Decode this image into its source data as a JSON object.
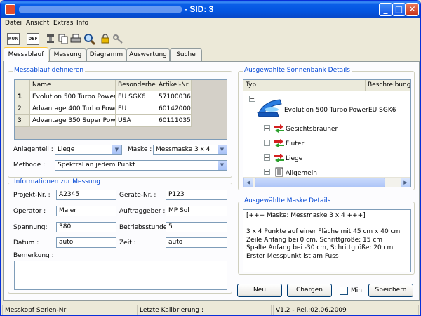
{
  "window": {
    "title": "- SID: 3",
    "controls": {
      "minimize": "_",
      "maximize": "□",
      "close": "✕"
    }
  },
  "menu": [
    "Datei",
    "Ansicht",
    "Extras",
    "Info"
  ],
  "toolbar": {
    "run_label": "RUN",
    "def_label": "DEF",
    "icons": [
      "run-icon",
      "def-icon",
      "tools-icon",
      "copy-icon",
      "print-icon",
      "search-icon",
      "lock-icon",
      "key-icon"
    ]
  },
  "tabs": [
    "Messablauf",
    "Messung",
    "Diagramm",
    "Auswertung",
    "Suche"
  ],
  "messablauf": {
    "title": "Messablauf definieren",
    "columns": [
      "Name",
      "Besonderheit",
      "Artikel-Nr"
    ],
    "rows": [
      {
        "index": "1",
        "name": "Evolution 500 Turbo Power",
        "besonderheit": "EU SGK6",
        "artikel": "57100036"
      },
      {
        "index": "2",
        "name": "Advantage 400 Turbo Power",
        "besonderheit": "EU",
        "artikel": "60142000"
      },
      {
        "index": "3",
        "name": "Advantage 350 Super Power",
        "besonderheit": "USA",
        "artikel": "60111035"
      }
    ],
    "anlagenteil_label": "Anlagenteil :",
    "anlagenteil_value": "Liege",
    "maske_label": "Maske :",
    "maske_value": "Messmaske 3 x 4",
    "methode_label": "Methode :",
    "methode_value": "Spektral an jedem Punkt"
  },
  "informationen": {
    "title": "Informationen zur Messung",
    "projekt_label": "Projekt-Nr. :",
    "projekt_value": "A2345",
    "geraete_label": "Geräte-Nr. :",
    "geraete_value": "P123",
    "operator_label": "Operator :",
    "operator_value": "Maier",
    "auftraggeber_label": "Auftraggeber :",
    "auftraggeber_value": "MP Sol",
    "spannung_label": "Spannung:",
    "spannung_value": "380",
    "betriebsstunden_label": "Betriebsstunden:",
    "betriebsstunden_value": "5",
    "datum_label": "Datum :",
    "datum_value": "auto",
    "zeit_label": "Zeit :",
    "zeit_value": "auto",
    "bemerkung_label": "Bemerkung :",
    "bemerkung_value": ""
  },
  "sonnenbank": {
    "title": "Ausgewählte Sonnenbank Details",
    "columns": [
      "Typ",
      "Beschreibung"
    ],
    "root_name": "Evolution 500 Turbo Power",
    "root_description": "EU SGK6",
    "children": [
      "Gesichtsbräuner",
      "Fluter",
      "Liege",
      "Allgemein"
    ]
  },
  "maske": {
    "title": "Ausgewählte Maske Details",
    "lines": [
      "[+++ Maske: Messmaske 3 x 4 +++]",
      "",
      "3 x 4 Punkte auf einer Fläche mit 45 cm x 40 cm",
      "Zeile Anfang bei 0 cm, Schrittgröße: 15 cm",
      "Spalte Anfang bei -30 cm, Schrittgröße: 20 cm",
      "Erster Messpunkt ist am Fuss"
    ]
  },
  "buttons": {
    "neu": "Neu",
    "chargen": "Chargen",
    "min": "Min",
    "speichern": "Speichern"
  },
  "status": {
    "messkopf": "Messkopf Serien-Nr:",
    "kalibrierung": "Letzte Kalibrierung :",
    "version": "V1.2 - Rel.:02.06.2009"
  },
  "colors": {
    "titlebar": "#0a5fe8",
    "group_title": "#0046d5",
    "panel": "#fcfcfe",
    "window": "#ece9d8"
  }
}
